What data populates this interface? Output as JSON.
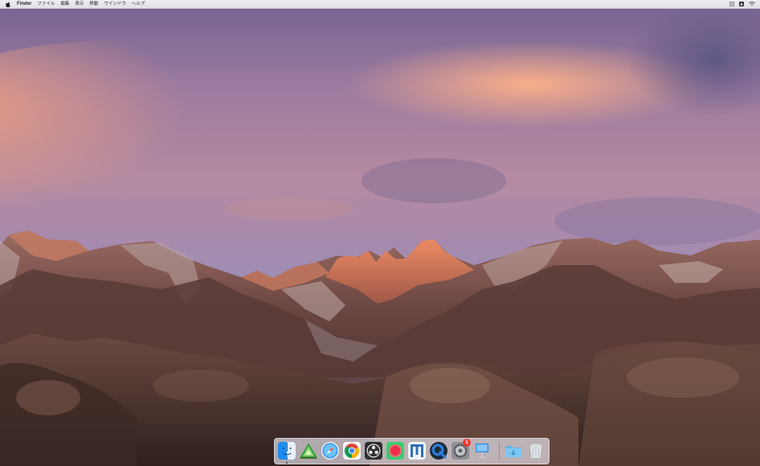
{
  "menubar": {
    "app_name": "Finder",
    "menus": [
      "ファイル",
      "編集",
      "表示",
      "移動",
      "ウインドウ",
      "ヘルプ"
    ]
  },
  "status_icons": [
    "keyboard-input-icon",
    "user-account-icon",
    "wifi-icon"
  ],
  "wallpaper": "macos-sierra-mountain-sunset",
  "dock": {
    "apps": [
      {
        "name": "Finder",
        "icon": "finder-icon",
        "running": true
      },
      {
        "name": "Xcode-like Developer App",
        "icon": "green-triangle-app-icon",
        "running": false
      },
      {
        "name": "Safari",
        "icon": "safari-icon",
        "running": false
      },
      {
        "name": "Google Chrome",
        "icon": "chrome-icon",
        "running": false
      },
      {
        "name": "OBS",
        "icon": "obs-icon",
        "running": false
      },
      {
        "name": "Recorder",
        "icon": "record-app-icon",
        "running": false
      },
      {
        "name": "Mindmap",
        "icon": "mindmap-app-icon",
        "running": false
      },
      {
        "name": "QuickTime Player",
        "icon": "quicktime-icon",
        "running": false
      },
      {
        "name": "System Preferences",
        "icon": "system-preferences-icon",
        "running": false,
        "badge": "1"
      },
      {
        "name": "Keynote",
        "icon": "keynote-icon",
        "running": false
      }
    ],
    "stack": {
      "name": "Downloads",
      "icon": "downloads-folder-icon"
    },
    "trash": {
      "name": "Trash",
      "icon": "trash-icon"
    }
  },
  "colors": {
    "menubar": "#ece8ee",
    "sky_top": "#7d6a95",
    "sky_glow": "#f2a07f",
    "mountain": "#6f4a45",
    "foreground": "#3a2724",
    "badge": "#ec3b33"
  }
}
